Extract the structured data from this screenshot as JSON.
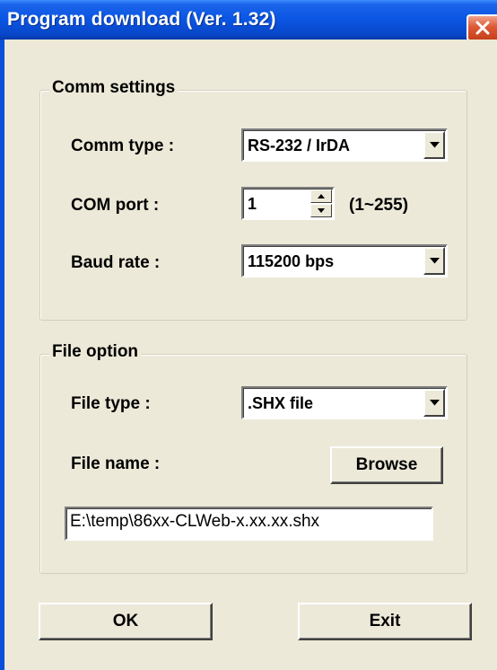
{
  "window": {
    "title": "Program download  (Ver. 1.32)",
    "title_color": "#ffffff",
    "titlebar_color": "#0a55e2",
    "close_color": "#dd5a36",
    "background": "#ece9d8"
  },
  "comm_settings": {
    "legend": "Comm settings",
    "comm_type_label": "Comm type :",
    "comm_type_value": "RS-232 / IrDA",
    "com_port_label": "COM port :",
    "com_port_value": "1",
    "com_port_range": "(1~255)",
    "baud_rate_label": "Baud rate :",
    "baud_rate_value": "115200 bps"
  },
  "file_option": {
    "legend": "File option",
    "file_type_label": "File type :",
    "file_type_value": ".SHX file",
    "file_name_label": "File name :",
    "browse_label": "Browse",
    "file_path_value": "E:\\temp\\86xx-CLWeb-x.xx.xx.shx"
  },
  "buttons": {
    "ok_label": "OK",
    "exit_label": "Exit"
  },
  "icons": {
    "close": "close-icon",
    "dropdown": "chevron-down-icon",
    "spin_up": "spin-up-icon",
    "spin_down": "spin-down-icon"
  }
}
